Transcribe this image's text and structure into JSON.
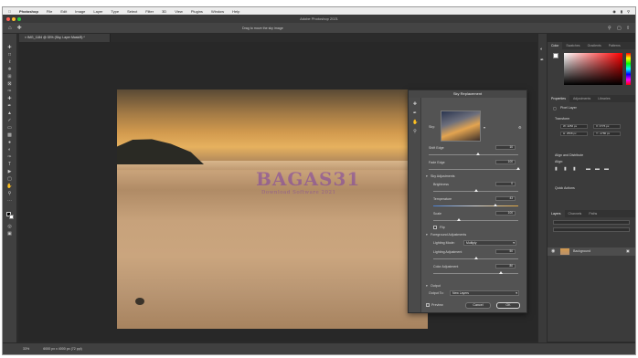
{
  "mac_menu": {
    "app": "Photoshop",
    "items": [
      "File",
      "Edit",
      "Image",
      "Layer",
      "Type",
      "Select",
      "Filter",
      "3D",
      "View",
      "Plugins",
      "Window",
      "Help"
    ]
  },
  "window": {
    "title": "Adobe Photoshop 2021"
  },
  "options_bar": {
    "hint": "Drag to move the sky image"
  },
  "document_tab": {
    "label": "IMG_1184 @ 33% (Sky, Layer Mask/8) *"
  },
  "watermark": {
    "main": "BAGAS31",
    "sub": "Download Software 2021"
  },
  "dialog": {
    "title": "Sky Replacement",
    "sky_label": "Sky:",
    "shift_edge": {
      "label": "Shift Edge",
      "value": "10"
    },
    "fade_edge": {
      "label": "Fade Edge",
      "value": "100"
    },
    "sky_adjustments": "Sky Adjustments",
    "brightness": {
      "label": "Brightness",
      "value": "0"
    },
    "temperature": {
      "label": "Temperature",
      "value": "43"
    },
    "scale": {
      "label": "Scale",
      "value": "100"
    },
    "flip": "Flip",
    "foreground_adjustments": "Foreground Adjustments",
    "lighting_mode": {
      "label": "Lighting Mode:",
      "value": "Multiply"
    },
    "lighting_adjustment": {
      "label": "Lighting Adjustment",
      "value": "50"
    },
    "color_adjustment": {
      "label": "Color Adjustment",
      "value": "80"
    },
    "output": "Output",
    "output_to": {
      "label": "Output To:",
      "value": "New Layers"
    },
    "preview": "Preview",
    "cancel": "Cancel",
    "ok": "OK"
  },
  "right_panels": {
    "color_tabs": [
      "Color",
      "Swatches",
      "Gradients",
      "Patterns"
    ],
    "properties_tabs": [
      "Properties",
      "Adjustments",
      "Libraries"
    ],
    "pixel_layer": "Pixel Layer",
    "transform": "Transform",
    "w": "W: 4256 px",
    "x": "X: 3776 px",
    "h": "H: 2568 px",
    "y": "Y: -1780 px",
    "align": "Align and Distribute",
    "align_sub": "Align:",
    "quick_actions": "Quick Actions",
    "layers_tabs": [
      "Layers",
      "Channels",
      "Paths"
    ],
    "layer_name": "Background"
  },
  "status": {
    "zoom": "33%",
    "doc": "6000 px x 4000 px (72 ppi)"
  },
  "colors": {
    "app_bg": "#2b2b2b",
    "panel": "#3b3b3b",
    "dialog": "#535353",
    "accent": "#d6d6d6"
  }
}
